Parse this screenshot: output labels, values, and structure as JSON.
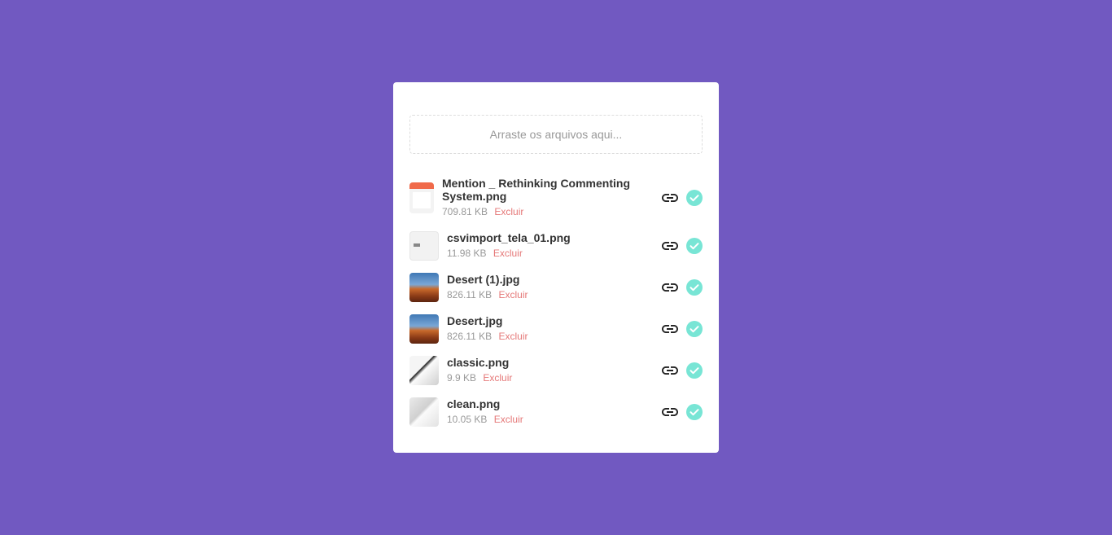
{
  "dropzone": {
    "placeholder": "Arraste os arquivos aqui..."
  },
  "files": [
    {
      "name": "Mention _ Rethinking Commenting System.png",
      "size": "709.81 KB",
      "delete_label": "Excluir",
      "thumb": "mention-screenshot"
    },
    {
      "name": "csvimport_tela_01.png",
      "size": "11.98 KB",
      "delete_label": "Excluir",
      "thumb": "csv-screenshot"
    },
    {
      "name": "Desert (1).jpg",
      "size": "826.11 KB",
      "delete_label": "Excluir",
      "thumb": "desert-photo"
    },
    {
      "name": "Desert.jpg",
      "size": "826.11 KB",
      "delete_label": "Excluir",
      "thumb": "desert-photo"
    },
    {
      "name": "classic.png",
      "size": "9.9 KB",
      "delete_label": "Excluir",
      "thumb": "classic-image"
    },
    {
      "name": "clean.png",
      "size": "10.05 KB",
      "delete_label": "Excluir",
      "thumb": "clean-image"
    }
  ],
  "icons": {
    "link": "link-icon",
    "success": "check-circle-icon"
  },
  "colors": {
    "background": "#7159c1",
    "delete": "#e57878",
    "success": "#78e5d5"
  }
}
